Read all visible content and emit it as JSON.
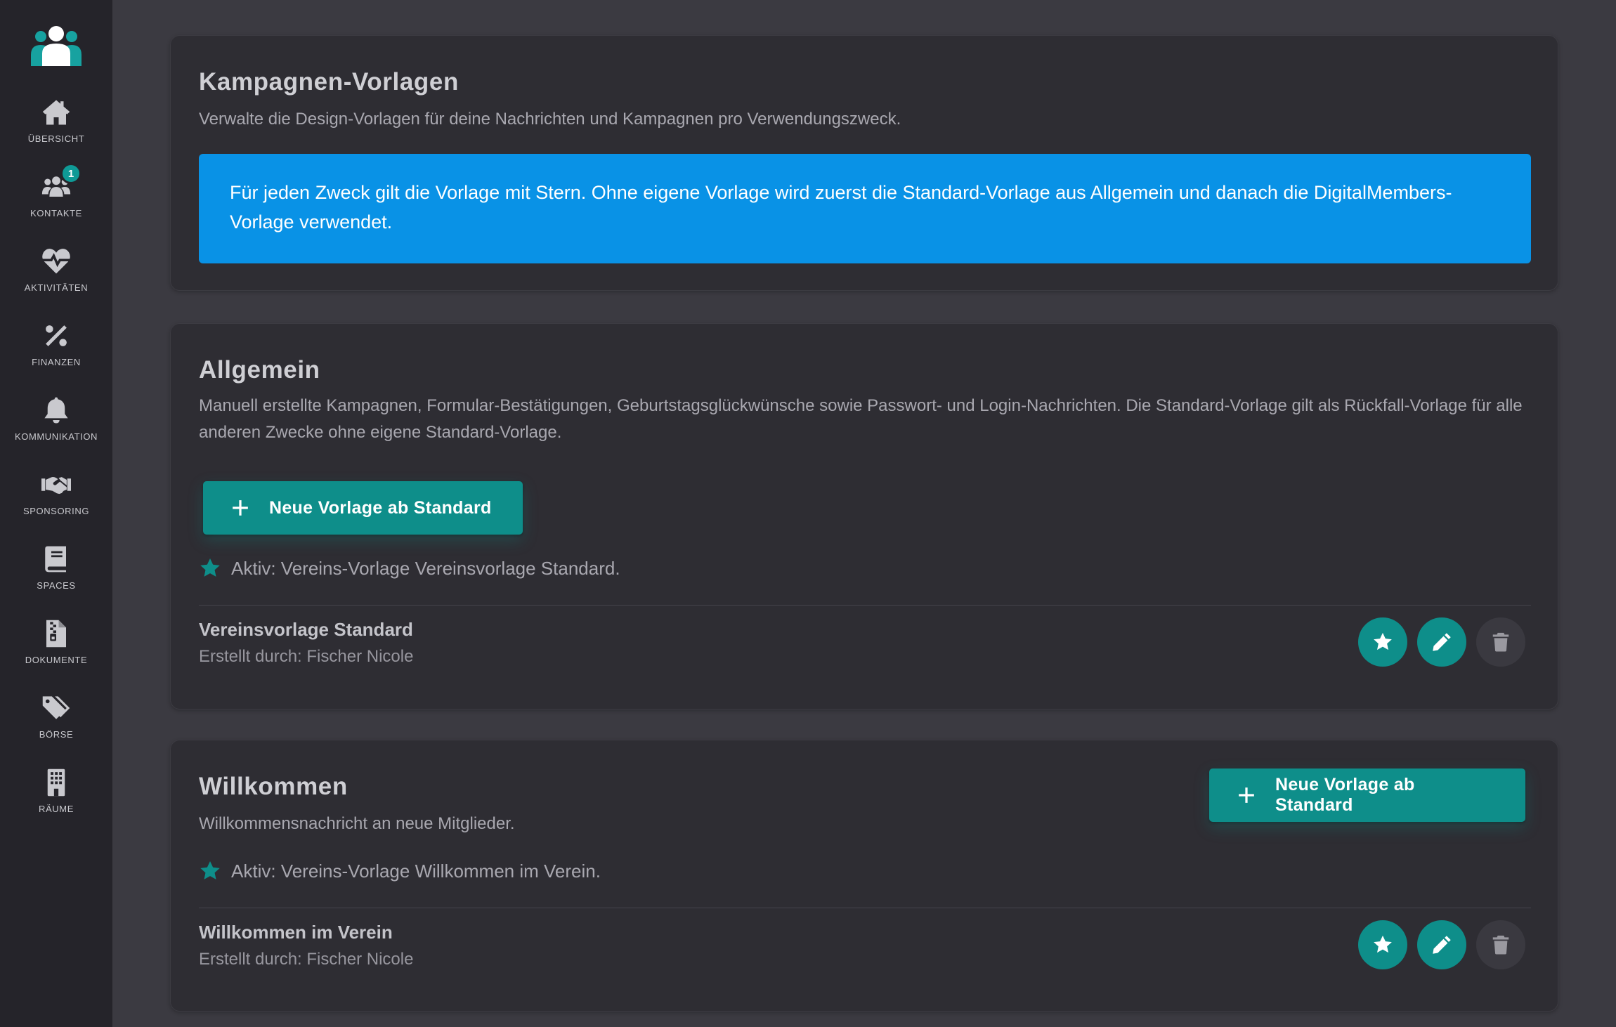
{
  "colors": {
    "accent": "#0e8e8a",
    "info": "#0992e6",
    "sidebar_bg": "#25242a",
    "page_bg": "#3b3a41",
    "card_bg": "#2e2d33"
  },
  "sidebar": {
    "logo_icon": "people-group-icon",
    "items": [
      {
        "label": "ÜBERSICHT",
        "icon": "home-icon"
      },
      {
        "label": "KONTAKTE",
        "icon": "users-icon",
        "badge": "1"
      },
      {
        "label": "AKTIVITÄTEN",
        "icon": "heart-pulse-icon"
      },
      {
        "label": "FINANZEN",
        "icon": "percent-icon"
      },
      {
        "label": "KOMMUNIKATION",
        "icon": "bell-icon"
      },
      {
        "label": "SPONSORING",
        "icon": "handshake-icon"
      },
      {
        "label": "SPACES",
        "icon": "book-icon"
      },
      {
        "label": "DOKUMENTE",
        "icon": "file-zipper-icon"
      },
      {
        "label": "BÖRSE",
        "icon": "tags-icon"
      },
      {
        "label": "RÄUME",
        "icon": "building-icon"
      }
    ]
  },
  "header_card": {
    "title": "Kampagnen-Vorlagen",
    "description": "Verwalte die Design-Vorlagen für deine Nachrichten und Kampagnen pro Verwendungszweck.",
    "info": "Für jeden Zweck gilt die Vorlage mit Stern. Ohne eigene Vorlage wird zuerst die Standard-Vorlage aus Allgemein und danach die DigitalMembers-Vorlage verwendet."
  },
  "sections": [
    {
      "title": "Allgemein",
      "description": "Manuell erstellte Kampagnen, Formular-Bestätigungen, Geburtstagsglückwünsche sowie Passwort- und Login-Nachrichten. Die Standard-Vorlage gilt als Rückfall-Vorlage für alle anderen Zwecke ohne eigene Standard-Vorlage.",
      "button_label": "Neue Vorlage ab Standard",
      "active_text": "Aktiv: Vereins-Vorlage Vereinsvorlage Standard.",
      "template": {
        "name": "Vereinsvorlage Standard",
        "author": "Erstellt durch: Fischer Nicole"
      }
    },
    {
      "title": "Willkommen",
      "description": "Willkommensnachricht an neue Mitglieder.",
      "button_label": "Neue Vorlage ab Standard",
      "active_text": "Aktiv: Vereins-Vorlage Willkommen im Verein.",
      "template": {
        "name": "Willkommen im Verein",
        "author": "Erstellt durch: Fischer Nicole"
      }
    }
  ]
}
